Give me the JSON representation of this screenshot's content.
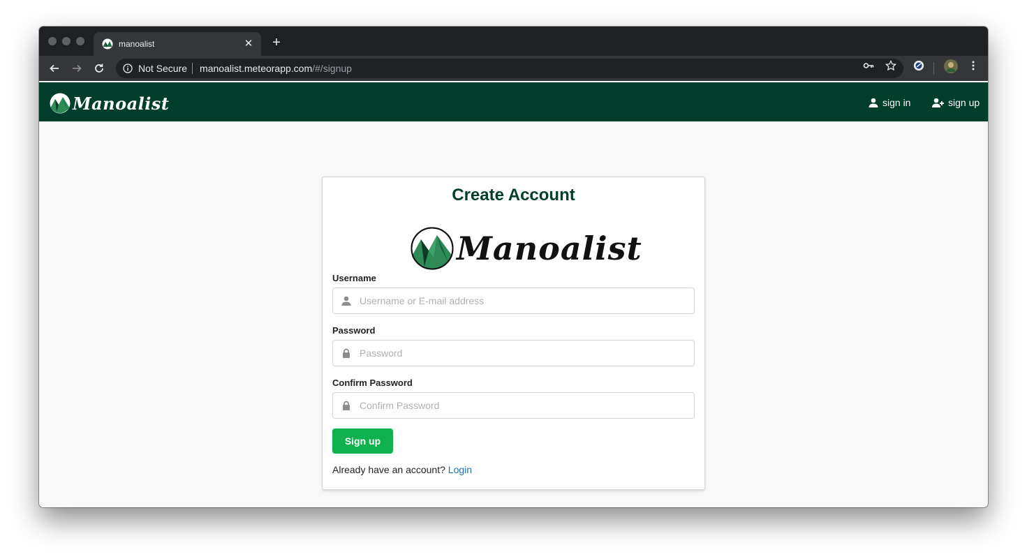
{
  "browser": {
    "tab_title": "manoalist",
    "new_tab_label": "+",
    "close_tab_label": "✕",
    "security_label": "Not Secure",
    "url_host": "manoalist.meteorapp.com",
    "url_path": "/#/signup"
  },
  "navbar": {
    "brand": "Manoalist",
    "sign_in": "sign in",
    "sign_up": "sign up",
    "background_color": "#003d2b"
  },
  "form": {
    "title": "Create Account",
    "brand": "Manoalist",
    "username": {
      "label": "Username",
      "placeholder": "Username or E-mail address"
    },
    "password": {
      "label": "Password",
      "placeholder": "Password"
    },
    "confirm_password": {
      "label": "Confirm Password",
      "placeholder": "Confirm Password"
    },
    "submit_label": "Sign up",
    "login_prompt": "Already have an account?",
    "login_link": "Login",
    "button_color": "#0fb14c"
  },
  "icons": [
    "back-icon",
    "forward-icon",
    "reload-icon",
    "info-icon",
    "key-icon",
    "star-icon",
    "extension-icon",
    "profile-avatar",
    "menu-icon",
    "user-icon",
    "user-plus-icon",
    "lock-icon"
  ]
}
